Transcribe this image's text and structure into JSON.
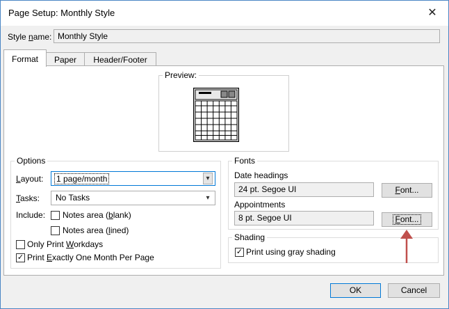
{
  "window": {
    "title": "Page Setup: Monthly Style",
    "close_glyph": "✕"
  },
  "style_name": {
    "label_pre": "Style ",
    "label_key": "n",
    "label_post": "ame:",
    "value": "Monthly Style"
  },
  "tabs": [
    {
      "label": "Format",
      "active": true
    },
    {
      "label": "Paper",
      "active": false
    },
    {
      "label": "Header/Footer",
      "active": false
    }
  ],
  "preview": {
    "label": "Preview:",
    "icon": "calendar-preview-icon"
  },
  "options": {
    "title": "Options",
    "layout_label_key": "L",
    "layout_label_rest": "ayout:",
    "layout_value": "1 page/month",
    "tasks_label_key": "T",
    "tasks_label_rest": "asks:",
    "tasks_value": "No Tasks",
    "include_label": "Include:",
    "notes_blank_pre": "Notes area (",
    "notes_blank_key": "b",
    "notes_blank_post": "lank)",
    "notes_blank_checked": false,
    "notes_lined_pre": "Notes area (",
    "notes_lined_key": "l",
    "notes_lined_post": "ined)",
    "notes_lined_checked": false,
    "workdays_pre": "Only Print ",
    "workdays_key": "W",
    "workdays_post": "orkdays",
    "workdays_checked": false,
    "onemonth_pre": "Print ",
    "onemonth_key": "E",
    "onemonth_post": "xactly One Month Per Page",
    "onemonth_checked": true,
    "check_glyph": "✓",
    "dropdown_glyph": "▾"
  },
  "fonts": {
    "title": "Fonts",
    "date_headings_label": "Date headings",
    "date_headings_value": "24 pt. Segoe UI",
    "appointments_label": "Appointments",
    "appointments_value": "8 pt. Segoe UI",
    "font_button_key": "F",
    "font_button_rest": "ont..."
  },
  "shading": {
    "title": "Shading",
    "gray_pre": "Print using ",
    "gray_key": "g",
    "gray_post": "ray shading",
    "gray_checked": true
  },
  "footer": {
    "ok_label": "OK",
    "cancel_label": "Cancel"
  },
  "colors": {
    "accent": "#0078d7",
    "arrow": "#c0504d",
    "window_border": "#4a86c5"
  }
}
